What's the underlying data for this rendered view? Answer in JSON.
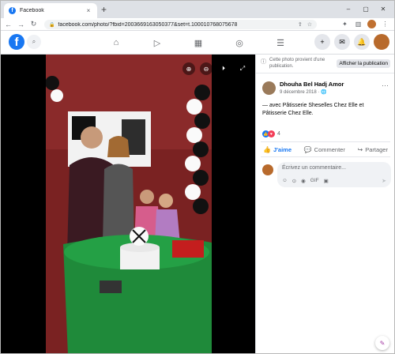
{
  "browser": {
    "tab_title": "Facebook",
    "tab_favicon": "f",
    "url": "facebook.com/photo/?fbid=2003669163050377&set=t.100010768075678",
    "new_tab_icon": "+",
    "back_icon": "←",
    "forward_icon": "→",
    "reload_icon": "↻",
    "lock_icon": "🔒",
    "share_icon": "⇪",
    "star_icon": "☆",
    "ext_puzzle_icon": "✦",
    "ext_sidebar_icon": "▥",
    "menu_icon": "⋮",
    "minimize_icon": "–",
    "maximize_icon": "▢",
    "close_icon": "✕",
    "tab_close_icon": "×"
  },
  "fb": {
    "logo": "f",
    "search_icon": "⌕",
    "nav": [
      "⌂",
      "▷",
      "▦",
      "◎",
      "☰"
    ],
    "right_icons": [
      "+",
      "✉",
      "🔔"
    ]
  },
  "viewer": {
    "zoom_in_icon": "⊕",
    "zoom_out_icon": "⊖",
    "tag_icon": "⏵",
    "fullscreen_icon": "⤢"
  },
  "panel": {
    "notice_icon": "ⓘ",
    "notice_text": "Cette photo provient d'une publication.",
    "notice_button": "Afficher la publication",
    "author_name": "Dhouha Bel Hadj Amor",
    "author_meta": "9 décembre 2018 · 🌐",
    "more_icon": "···",
    "caption": "— avec Pâtisserie Sheselles Chez Elle et Pâtisserie Chez Elle.",
    "reaction_count": "4",
    "like_label": "J'aime",
    "comment_label": "Commenter",
    "share_label": "Partager",
    "like_icon": "👍",
    "comment_icon": "💬",
    "share_icon": "↪",
    "comment_placeholder": "Écrivez un commentaire...",
    "comment_tools": [
      "☺",
      "⊙",
      "◉",
      "GIF",
      "▣"
    ],
    "send_icon": "➤"
  }
}
